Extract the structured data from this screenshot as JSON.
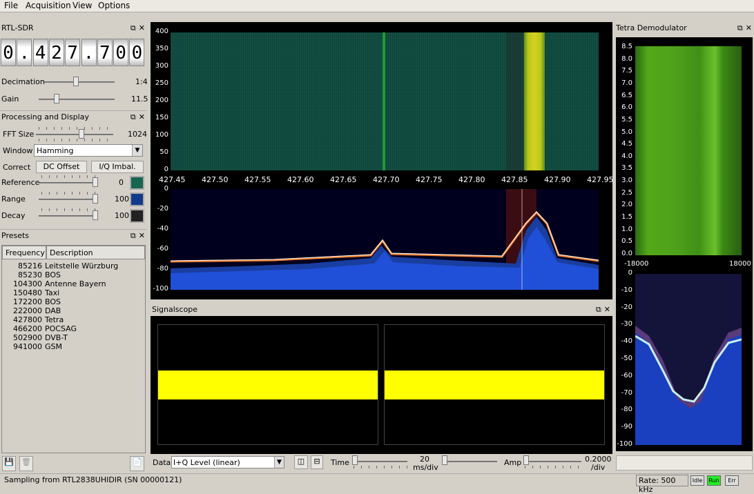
{
  "menu": [
    "File",
    "Acquisition",
    "View",
    "Options"
  ],
  "rtl": {
    "title": "RTL-SDR",
    "digits": [
      "0",
      ".",
      "4",
      "2",
      "7",
      ".",
      "7",
      "0",
      "0"
    ],
    "decimation_label": "Decimation",
    "decimation_value": "1:4",
    "decimation_fraction": 0.45,
    "gain_label": "Gain",
    "gain_value": "11.5",
    "gain_fraction": 0.22
  },
  "proc": {
    "title": "Processing and Display",
    "fft_label": "FFT Size",
    "fft_value": "1024",
    "fft_fraction": 0.6,
    "window_label": "Window",
    "window_value": "Hamming",
    "correct_label": "Correct",
    "dc_label": "DC Offset",
    "iq_label": "I/Q Imbal.",
    "reference_label": "Reference",
    "reference_value": "0",
    "range_label": "Range",
    "range_value": "100",
    "decay_label": "Decay",
    "decay_value": "100"
  },
  "presets": {
    "title": "Presets",
    "col_freq": "Frequency",
    "col_desc": "Description",
    "rows": [
      {
        "f": "85216",
        "d": "Leitstelle Würzburg"
      },
      {
        "f": "85230",
        "d": "BOS"
      },
      {
        "f": "104300",
        "d": "Antenne Bayern"
      },
      {
        "f": "150480",
        "d": "Taxi"
      },
      {
        "f": "172200",
        "d": "BOS"
      },
      {
        "f": "222000",
        "d": "DAB"
      },
      {
        "f": "427800",
        "d": "Tetra"
      },
      {
        "f": "466200",
        "d": "POCSAG"
      },
      {
        "f": "502900",
        "d": "DVB-T"
      },
      {
        "f": "941000",
        "d": "GSM"
      }
    ]
  },
  "waterfall": {
    "yticks": [
      "400",
      "350",
      "300",
      "250",
      "200",
      "150",
      "100",
      "50",
      "0"
    ]
  },
  "spectrum": {
    "xticks": [
      "427.45",
      "427.50",
      "427.55",
      "427.60",
      "427.65",
      "427.70",
      "427.75",
      "427.80",
      "427.85",
      "427.90",
      "427.95"
    ],
    "yticks": [
      "0",
      "-20",
      "-40",
      "-60",
      "-80",
      "-100"
    ]
  },
  "scope": {
    "title": "Signalscope",
    "data_label": "Data",
    "data_value": "I+Q Level (linear)",
    "time_label": "Time",
    "time_value": "20",
    "time_unit": "ms/div",
    "amp_label": "Amp",
    "amp_value": "0.2000",
    "amp_unit": "/div"
  },
  "tetra": {
    "title": "Tetra Demodulator",
    "wf_yticks": [
      "8.5",
      "8.0",
      "7.5",
      "7.0",
      "6.5",
      "6.0",
      "5.5",
      "5.0",
      "4.5",
      "4.0",
      "3.5",
      "3.0",
      "2.5",
      "2.0",
      "1.5",
      "1.0",
      "0.5",
      "0.0"
    ],
    "x_left": "-18000",
    "x_right": "18000",
    "spec_yticks": [
      "0",
      "-10",
      "-20",
      "-30",
      "-40",
      "-50",
      "-60",
      "-70",
      "-80",
      "-90",
      "-100"
    ]
  },
  "status": {
    "text": "Sampling from RTL2838UHIDIR (SN 00000121)",
    "rate": "Rate: 500 kHz",
    "idle": "Idle",
    "run": "Run",
    "err": "Err"
  },
  "colors": {
    "waterfall_bg": "#0f4a3e",
    "spectrum_bg": "#000022",
    "scope_trace": "#ffff00",
    "tetra_green": "#5fb31e",
    "run_green": "#22ee22"
  }
}
